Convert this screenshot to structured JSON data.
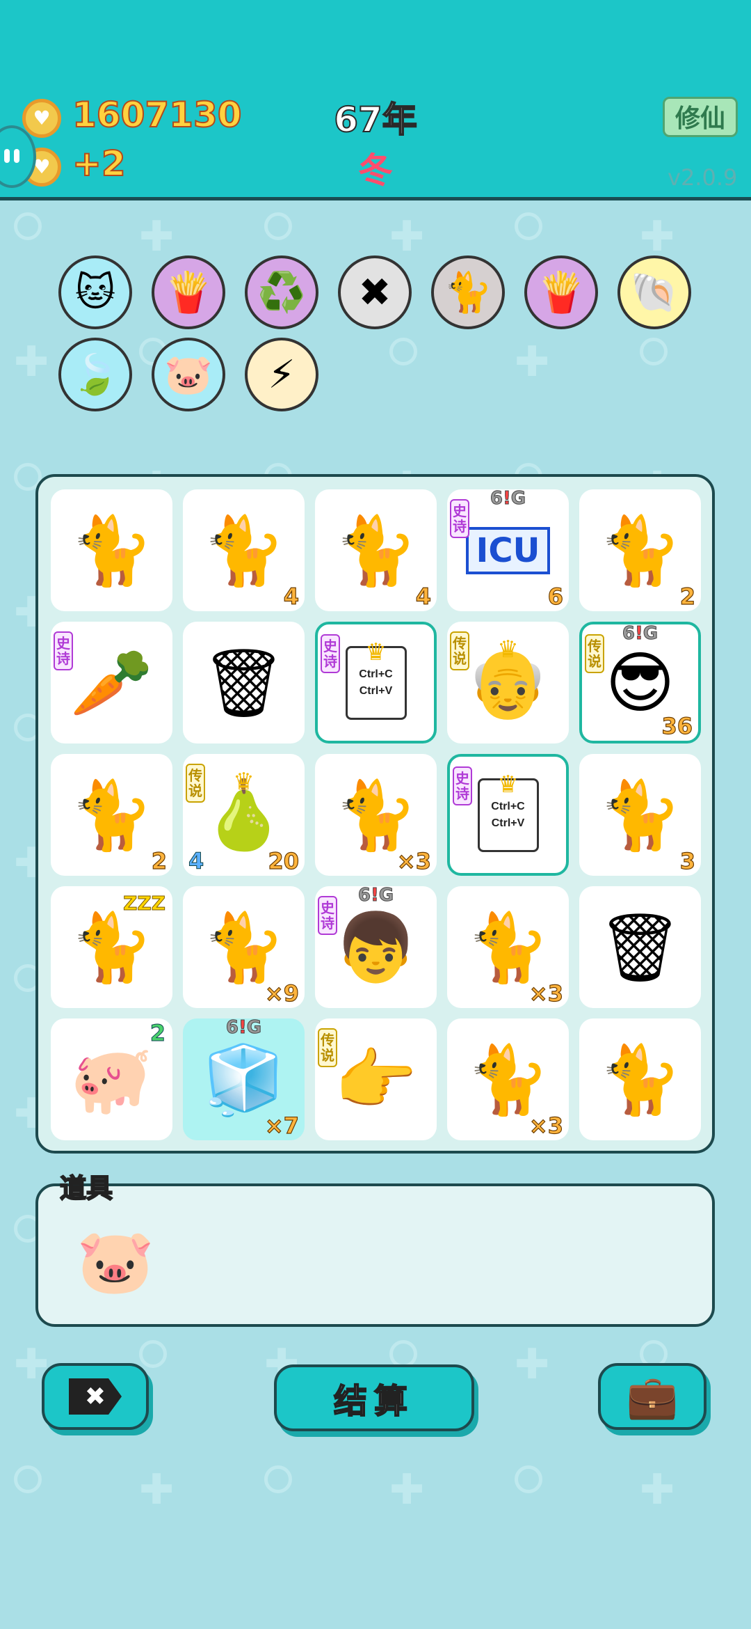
{
  "header": {
    "coins": "1607130",
    "coin_gain": "+2",
    "year": "67年",
    "season": "冬",
    "mode_button": "修仙",
    "version": "v2.0.9"
  },
  "skills": [
    {
      "icon": "cat-icon",
      "glyph": "🐱",
      "bg": "#a9ecf7"
    },
    {
      "icon": "fries-icon",
      "glyph": "🍟",
      "bg": "#d6a6e6"
    },
    {
      "icon": "recycle-icon",
      "glyph": "♻️",
      "bg": "#d6a6e6"
    },
    {
      "icon": "delete-tag-icon",
      "glyph": "✖",
      "bg": "#e2e2e2"
    },
    {
      "icon": "cats-pair-icon",
      "glyph": "🐈",
      "bg": "#d6d0d0"
    },
    {
      "icon": "fries-icon",
      "glyph": "🍟",
      "bg": "#d6a6e6"
    },
    {
      "icon": "shell-icon",
      "glyph": "🐚",
      "bg": "#fff6a8"
    },
    {
      "icon": "leaf-icon",
      "glyph": "🍃",
      "bg": "#a9ecf7"
    },
    {
      "icon": "piggy-bank-icon",
      "glyph": "🐷",
      "bg": "#a9ecf7"
    },
    {
      "icon": "lightning-icon",
      "glyph": "⚡",
      "bg": "#fff0c8"
    }
  ],
  "board": [
    {
      "item": "cat",
      "glyph": "🐈",
      "num": ""
    },
    {
      "item": "cat",
      "glyph": "🐈",
      "num": "4"
    },
    {
      "item": "cat",
      "glyph": "🐈",
      "num": "4"
    },
    {
      "item": "icu",
      "text": "ICU",
      "num": "6",
      "rarity": "史诗",
      "rclass": "epic",
      "sixg": true
    },
    {
      "item": "cat",
      "glyph": "🐈",
      "num": "2"
    },
    {
      "item": "carrot",
      "glyph": "🥕",
      "num": "",
      "rarity": "史诗",
      "rclass": "epic"
    },
    {
      "item": "trash-bag",
      "glyph": "🗑",
      "num": ""
    },
    {
      "item": "copy-paste",
      "card": [
        "Ctrl+C",
        "Ctrl+V"
      ],
      "num": "",
      "rarity": "史诗",
      "rclass": "epic",
      "hl": true,
      "crown": true
    },
    {
      "item": "old-man-king",
      "glyph": "👴",
      "num": "",
      "rarity": "传说",
      "rclass": "legend",
      "crown": true
    },
    {
      "item": "sunglasses-man",
      "glyph": "😎",
      "num": "36",
      "rarity": "传说",
      "rclass": "legend",
      "hl": true,
      "sixg": true
    },
    {
      "item": "cat",
      "glyph": "🐈",
      "num": "2"
    },
    {
      "item": "pear-king",
      "glyph": "🍐",
      "num": "20",
      "left": "4",
      "rarity": "传说",
      "rclass": "legend",
      "crown": true
    },
    {
      "item": "cat",
      "glyph": "🐈",
      "num": "×3"
    },
    {
      "item": "copy-paste",
      "card": [
        "Ctrl+C",
        "Ctrl+V"
      ],
      "num": "",
      "rarity": "史诗",
      "rclass": "epic",
      "hl": true,
      "crown": true
    },
    {
      "item": "cat",
      "glyph": "🐈",
      "num": "3"
    },
    {
      "item": "sleeping-cat",
      "glyph": "🐈",
      "num": "",
      "zzz": "ZZZ"
    },
    {
      "item": "cat",
      "glyph": "🐈",
      "num": "×9"
    },
    {
      "item": "red-cap-boy",
      "glyph": "👦",
      "num": "",
      "rarity": "史诗",
      "rclass": "epic",
      "sixg": true
    },
    {
      "item": "cat",
      "glyph": "🐈",
      "num": "×3"
    },
    {
      "item": "trash-bag",
      "glyph": "🗑",
      "num": ""
    },
    {
      "item": "pig",
      "glyph": "🐖",
      "num": "",
      "tr": "2"
    },
    {
      "item": "fridge",
      "glyph": "🧊",
      "num": "×7",
      "teal": true,
      "sixg": true
    },
    {
      "item": "pointing-hand",
      "glyph": "👉",
      "num": "",
      "rarity": "传说",
      "rclass": "legend"
    },
    {
      "item": "cat",
      "glyph": "🐈",
      "num": "×3"
    },
    {
      "item": "cat",
      "glyph": "🐈",
      "num": ""
    }
  ],
  "sixg_label": [
    "6",
    "!",
    "G"
  ],
  "tools": {
    "title": "道具",
    "items": [
      {
        "icon": "piggy-bank-icon",
        "glyph": "🐷"
      }
    ]
  },
  "bottom": {
    "delete_label": "✖",
    "settle_label": "结算",
    "bag_glyph": "💼"
  }
}
